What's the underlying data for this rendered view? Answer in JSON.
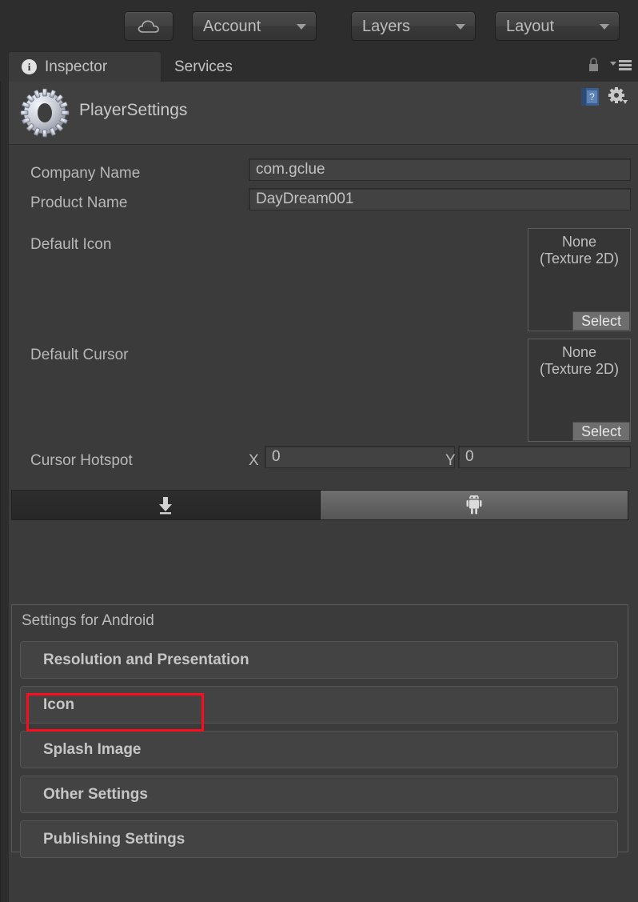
{
  "toolbar": {
    "cloud_button": {
      "icon": "cloud-icon"
    },
    "buttons": [
      {
        "label": "Account",
        "icon": "chevron-down-icon"
      },
      {
        "label": "Layers",
        "icon": "chevron-down-icon"
      },
      {
        "label": "Layout",
        "icon": "chevron-down-icon"
      }
    ]
  },
  "tabbar": {
    "tabs": [
      {
        "label": "Inspector",
        "badge": "i",
        "active": true
      },
      {
        "label": "Services",
        "active": false
      }
    ],
    "lock_icon": "lock-icon",
    "menu_icon": "hamburger-menu-icon"
  },
  "component": {
    "title": "PlayerSettings",
    "icon": "gear-icon",
    "help_icon": "help-book-icon",
    "settings_icon": "gear-dropdown-icon"
  },
  "properties": {
    "company_name": {
      "label": "Company Name",
      "value": "com.gclue"
    },
    "product_name": {
      "label": "Product Name",
      "value": "DayDream001"
    },
    "default_icon": {
      "label": "Default Icon",
      "value_line1": "None",
      "value_line2": "(Texture 2D)",
      "select_label": "Select"
    },
    "default_cursor": {
      "label": "Default Cursor",
      "value_line1": "None",
      "value_line2": "(Texture 2D)",
      "select_label": "Select"
    },
    "cursor_hotspot": {
      "label": "Cursor Hotspot",
      "x_label": "X",
      "x_value": "0",
      "y_label": "Y",
      "y_value": "0"
    }
  },
  "platform_tabs": [
    {
      "icon": "standalone-download-icon",
      "selected": true
    },
    {
      "icon": "android-robot-icon",
      "selected": false
    }
  ],
  "settings": {
    "heading": "Settings for Android",
    "sections": [
      {
        "label": "Resolution and Presentation",
        "highlighted": false
      },
      {
        "label": "Icon",
        "highlighted": false
      },
      {
        "label": "Splash Image",
        "highlighted": false
      },
      {
        "label": "Other Settings",
        "highlighted": true
      },
      {
        "label": "Publishing Settings",
        "highlighted": false
      }
    ]
  },
  "annotation": {
    "highlight_color": "#fc0d1b",
    "target": "Other Settings"
  }
}
